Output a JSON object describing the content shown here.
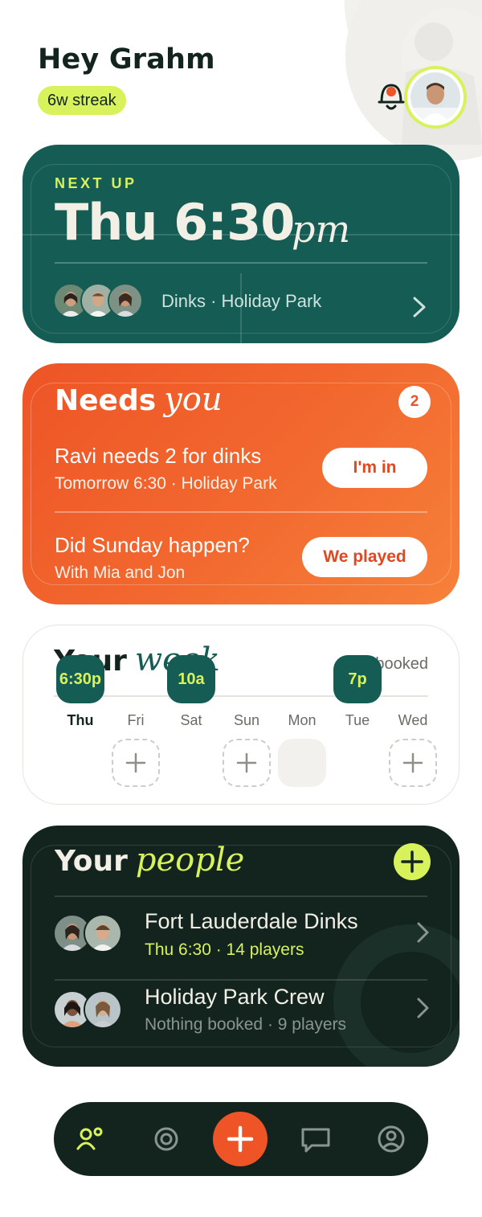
{
  "header": {
    "greeting": "Hey Grahm",
    "streak": "6w streak",
    "has_notification": true
  },
  "next_up": {
    "label": "NEXT UP",
    "time": "Thu 6:30",
    "ampm": "pm",
    "where": "Dinks · Holiday Park",
    "attendee_count": 3
  },
  "needs_you": {
    "title_a": "Needs",
    "title_b": "you",
    "count": "2",
    "items": [
      {
        "title": "Ravi needs 2 for dinks",
        "sub": "Tomorrow 6:30 · Holiday Park",
        "action": "I'm in"
      },
      {
        "title": "Did Sunday happen?",
        "sub": "With Mia and Jon",
        "action": "We played"
      }
    ]
  },
  "week": {
    "title_a": "Your",
    "title_b": "week",
    "booked": "3 booked",
    "days": [
      {
        "label": "Thu",
        "slot": "6:30p",
        "state": "booked",
        "today": true
      },
      {
        "label": "Fri",
        "slot": "",
        "state": "add"
      },
      {
        "label": "Sat",
        "slot": "10a",
        "state": "booked"
      },
      {
        "label": "Sun",
        "slot": "",
        "state": "add"
      },
      {
        "label": "Mon",
        "slot": "",
        "state": "empty"
      },
      {
        "label": "Tue",
        "slot": "7p",
        "state": "booked"
      },
      {
        "label": "Wed",
        "slot": "",
        "state": "add"
      }
    ]
  },
  "people": {
    "title_a": "Your",
    "title_b": "people",
    "groups": [
      {
        "name": "Fort Lauderdale Dinks",
        "meta": "Thu 6:30 · 14 players",
        "active": true
      },
      {
        "name": "Holiday Park Crew",
        "meta": "Nothing booked · 9 players",
        "active": false
      }
    ]
  },
  "nav": {
    "items": [
      "people-icon",
      "target-icon",
      "add-icon",
      "chat-icon",
      "profile-icon"
    ],
    "active": "people-icon"
  },
  "colors": {
    "accent_lime": "#d7f25a",
    "deep_green": "#145c54",
    "dark": "#13241f",
    "orange": "#ee5426"
  }
}
